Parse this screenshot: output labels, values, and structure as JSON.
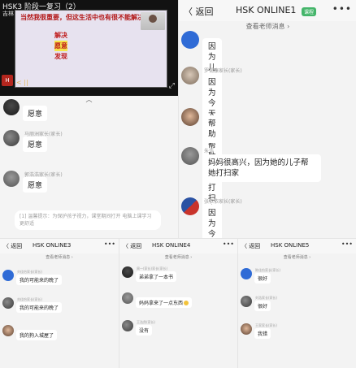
{
  "panel_a": {
    "video": {
      "title": "HSK3 阶段一复习（2）",
      "subtitle": "吉林",
      "slide_heading": "当然我很重要，但这生活中也有很不能解决的问题",
      "slide_words": [
        "解决",
        "愿意",
        "发现"
      ],
      "logo_text": "H",
      "control_left": "< ||",
      "control_right": "⤢"
    },
    "collapse_label": "︿",
    "messages": [
      {
        "name": "",
        "text": "愿意"
      },
      {
        "name": "马丽洲家长(家长)",
        "text": "愿意"
      },
      {
        "name": "郭浩浩家长(家长)",
        "text": "愿意"
      }
    ],
    "notice": "[1] 温馨提示：为保护孩子视力，课堂期间打开 电脑上课学习更舒适"
  },
  "panel_b": {
    "back_label": "〈 返回",
    "title": "HSK ONLINE1",
    "badge": "课程",
    "more": "•••",
    "teacher_bar": "查看老师消息 ›",
    "messages": [
      {
        "name": "",
        "text": "因为儿子自己打扫房间了"
      },
      {
        "name": "罗锡康家长(家长)",
        "text": "因为今天孩子帮助妈妈打扫房间"
      },
      {
        "name": "",
        "text": "帮助"
      },
      {
        "name": "朱浩",
        "text": "妈妈很高兴，因为她的儿子帮她打扫家"
      },
      {
        "name": "张依依家长(家长)",
        "text": "因为今天儿子就了"
      }
    ]
  },
  "bottom_panels": [
    {
      "back_label": "〈 返回",
      "title": "HSK ONLINE3",
      "more": "•••",
      "teacher_bar": "查看老师消息 ›",
      "messages": [
        {
          "name": "刘佳怡家长(家长)",
          "text": "我的可能来的晚了"
        },
        {
          "name": "刘佳怡家长(家长)",
          "text": "我的可能来的晚了"
        },
        {
          "name": "",
          "text": "我的狗入城屋了"
        }
      ]
    },
    {
      "back_label": "〈 返回",
      "title": "HSK ONLINE4",
      "more": "•••",
      "teacher_bar": "查看老师消息 ›",
      "messages": [
        {
          "name": "周一(家长)家长(家长)",
          "text": "弟弟拿了一本书"
        },
        {
          "name": "",
          "text": "妈妈拿来了一点东西"
        },
        {
          "name": "王浩然(家长)",
          "text": "没有"
        }
      ]
    },
    {
      "back_label": "〈 返回",
      "title": "HSK ONLINE5",
      "more": "•••",
      "teacher_bar": "查看老师消息 ›",
      "messages": [
        {
          "name": "陈佳怡家长(家长)",
          "text": "很好"
        },
        {
          "name": "刘浩家长(家长)",
          "text": "很好"
        },
        {
          "name": "王家家长(家长)",
          "text": "我错"
        }
      ]
    }
  ]
}
